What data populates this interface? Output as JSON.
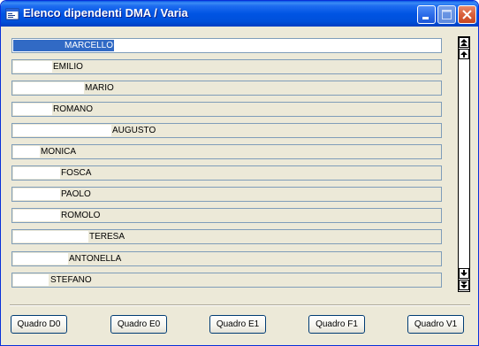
{
  "window": {
    "title": "Elenco dipendenti DMA / Varia"
  },
  "list": {
    "items": [
      {
        "label": "MARCELLO",
        "selected": true
      },
      {
        "label": "EMILIO"
      },
      {
        "label": "MARIO"
      },
      {
        "label": "ROMANO"
      },
      {
        "label": "AUGUSTO"
      },
      {
        "label": "MONICA"
      },
      {
        "label": "FOSCA"
      },
      {
        "label": "PAOLO"
      },
      {
        "label": "ROMOLO"
      },
      {
        "label": "TERESA"
      },
      {
        "label": "ANTONELLA"
      },
      {
        "label": "STEFANO"
      }
    ]
  },
  "buttons": {
    "quadro_d0": "Quadro D0",
    "quadro_e0": "Quadro E0",
    "quadro_e1": "Quadro E1",
    "quadro_f1": "Quadro F1",
    "quadro_v1": "Quadro V1"
  },
  "icons": {
    "app": "app-window-icon",
    "minimize": "minimize-icon",
    "maximize": "maximize-icon",
    "close": "close-icon",
    "scroll_top": "scroll-to-top-icon",
    "scroll_up": "scroll-up-icon",
    "scroll_down": "scroll-down-icon",
    "scroll_bottom": "scroll-to-bottom-icon"
  },
  "colors": {
    "titlebar": "#0054e3",
    "window_face": "#ece9d8",
    "field_border": "#7f9db9",
    "selection": "#316ac5"
  }
}
